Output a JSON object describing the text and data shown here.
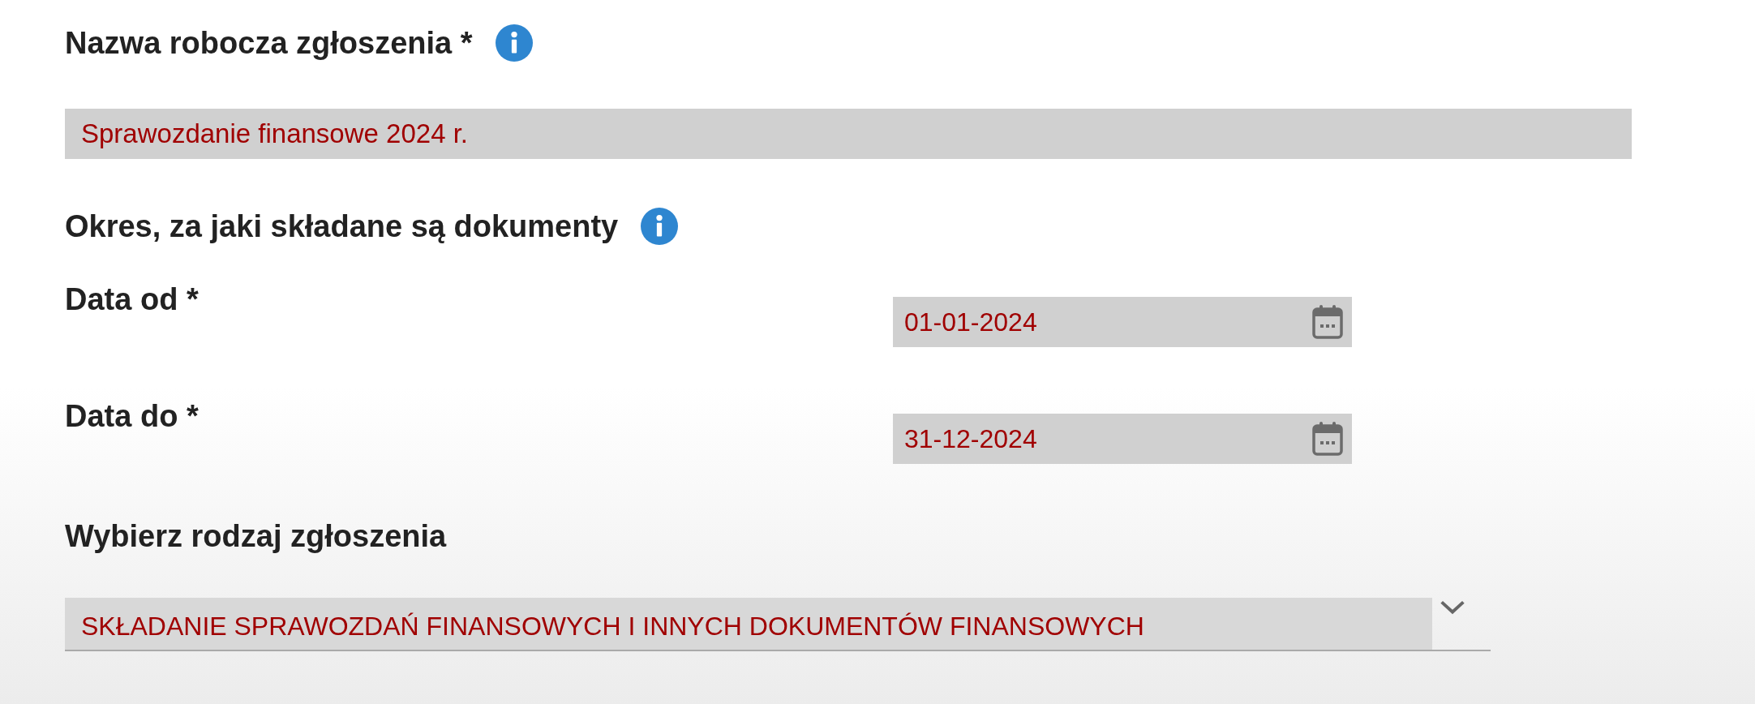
{
  "title_field": {
    "label": "Nazwa robocza zgłoszenia *",
    "value": "Sprawozdanie finansowe 2024 r."
  },
  "period": {
    "heading": "Okres, za jaki składane są dokumenty",
    "dates": [
      {
        "label": "Data od *",
        "value": "01-01-2024"
      },
      {
        "label": "Data do *",
        "value": "31-12-2024"
      }
    ]
  },
  "type_select": {
    "label": "Wybierz rodzaj zgłoszenia",
    "value": "SKŁADANIE SPRAWOZDAŃ FINANSOWYCH I INNYCH DOKUMENTÓW FINANSOWYCH"
  }
}
